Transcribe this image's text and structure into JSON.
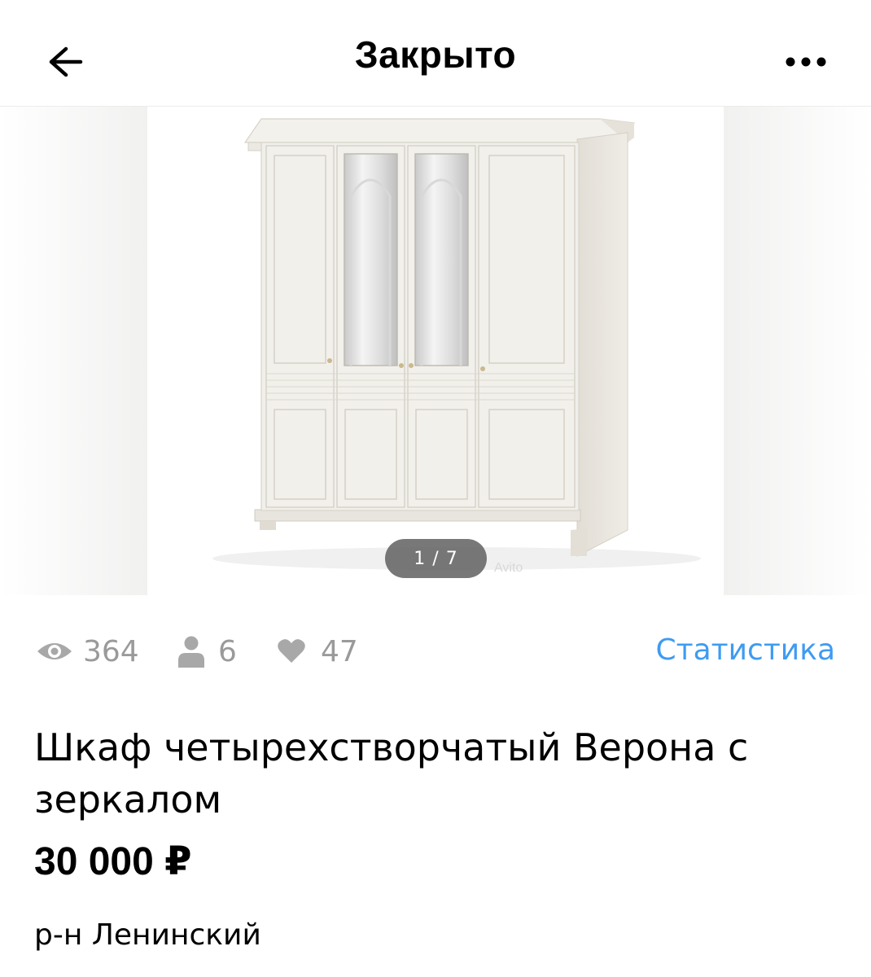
{
  "header": {
    "title": "Закрыто",
    "back_icon": "arrow-left-icon",
    "more_icon": "more-horizontal-icon"
  },
  "gallery": {
    "counter": "1 / 7",
    "watermark": "Avito",
    "image_subject": "wardrobe-photo"
  },
  "stats": {
    "views": "364",
    "contacts": "6",
    "favorites": "47",
    "link_label": "Статистика",
    "link_color": "#3e9bf2",
    "icon_color": "#9a9a9a"
  },
  "listing": {
    "title": "Шкаф четырехстворчатый Верона с зеркалом",
    "price": "30 000 ₽",
    "location": "р-н Ленинский"
  }
}
